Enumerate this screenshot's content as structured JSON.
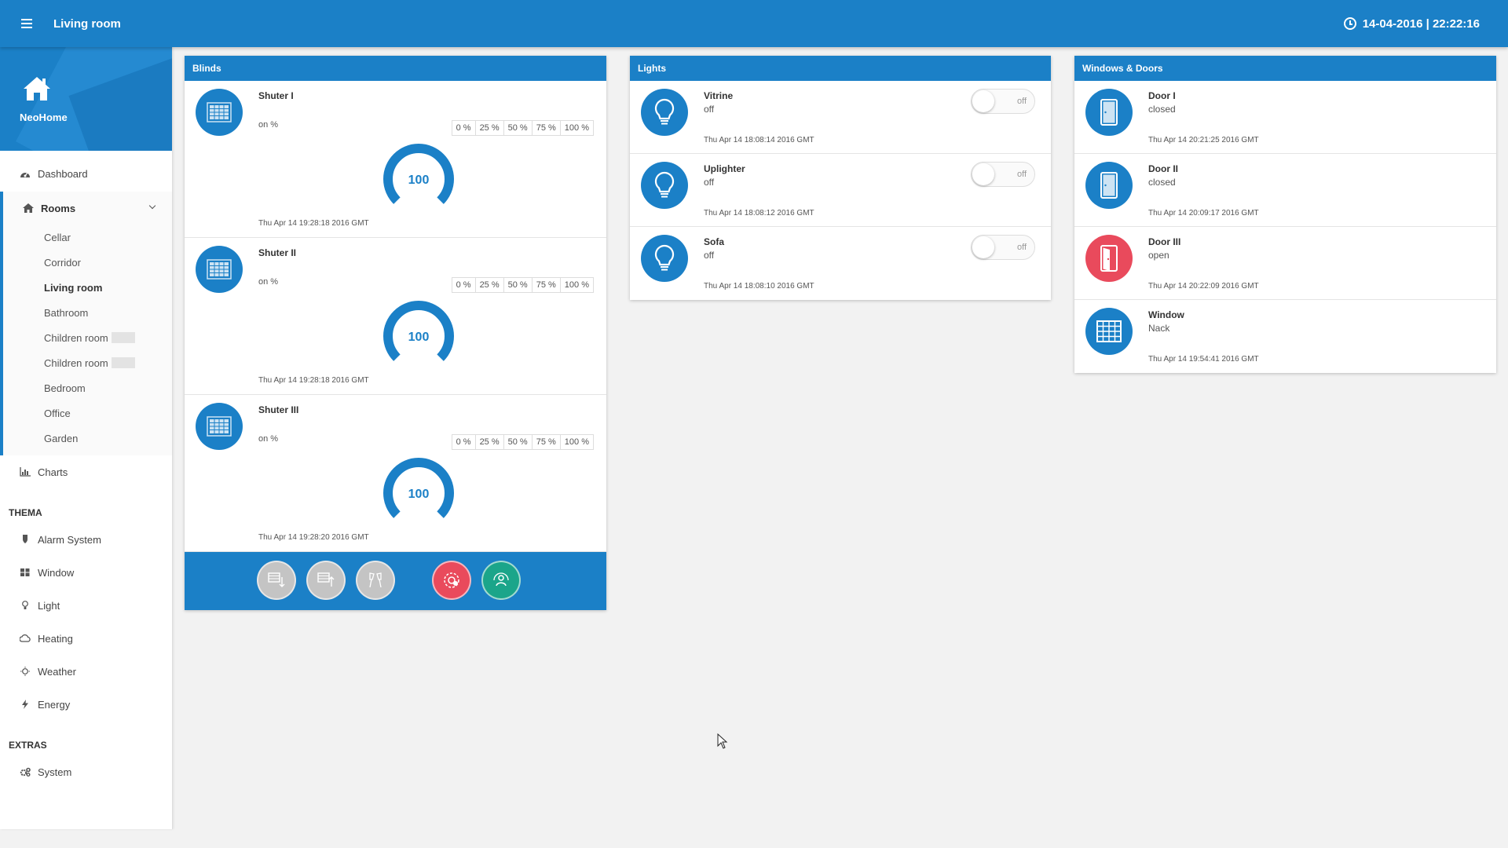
{
  "header": {
    "title": "Living room",
    "datetime": "14-04-2016 | 22:22:16"
  },
  "brand": {
    "name": "NeoHome"
  },
  "sidebar": {
    "dashboard": "Dashboard",
    "rooms_label": "Rooms",
    "rooms": [
      "Cellar",
      "Corridor",
      "Living room",
      "Bathroom",
      "Children room",
      "Children room",
      "Bedroom",
      "Office",
      "Garden"
    ],
    "active_room": "Living room",
    "charts": "Charts",
    "thema_title": "THEMA",
    "thema": [
      "Alarm System",
      "Window",
      "Light",
      "Heating",
      "Weather",
      "Energy"
    ],
    "extras_title": "EXTRAS",
    "extras": [
      "System"
    ]
  },
  "blinds": {
    "title": "Blinds",
    "items": [
      {
        "name": "Shuter I",
        "status": "on %",
        "value": 100,
        "time": "Thu Apr 14 19:28:18 2016 GMT"
      },
      {
        "name": "Shuter II",
        "status": "on %",
        "value": 100,
        "time": "Thu Apr 14 19:28:18 2016 GMT"
      },
      {
        "name": "Shuter III",
        "status": "on %",
        "value": 100,
        "time": "Thu Apr 14 19:28:20 2016 GMT"
      }
    ],
    "percent_options": [
      "0 %",
      "25 %",
      "50 %",
      "75 %",
      "100 %"
    ]
  },
  "lights": {
    "title": "Lights",
    "items": [
      {
        "name": "Vitrine",
        "status": "off",
        "toggle": "off",
        "time": "Thu Apr 14 18:08:14 2016 GMT"
      },
      {
        "name": "Uplighter",
        "status": "off",
        "toggle": "off",
        "time": "Thu Apr 14 18:08:12 2016 GMT"
      },
      {
        "name": "Sofa",
        "status": "off",
        "toggle": "off",
        "time": "Thu Apr 14 18:08:10 2016 GMT"
      }
    ]
  },
  "windows_doors": {
    "title": "Windows & Doors",
    "items": [
      {
        "name": "Door I",
        "status": "closed",
        "time": "Thu Apr 14 20:21:25 2016 GMT"
      },
      {
        "name": "Door II",
        "status": "closed",
        "time": "Thu Apr 14 20:09:17 2016 GMT"
      },
      {
        "name": "Door III",
        "status": "open",
        "time": "Thu Apr 14 20:22:09 2016 GMT"
      },
      {
        "name": "Window",
        "status": "Nack",
        "time": "Thu Apr 14 19:54:41 2016 GMT"
      }
    ]
  },
  "colors": {
    "primary": "#1b80c7",
    "alert": "#e94a5c",
    "success": "#1ba58a"
  }
}
